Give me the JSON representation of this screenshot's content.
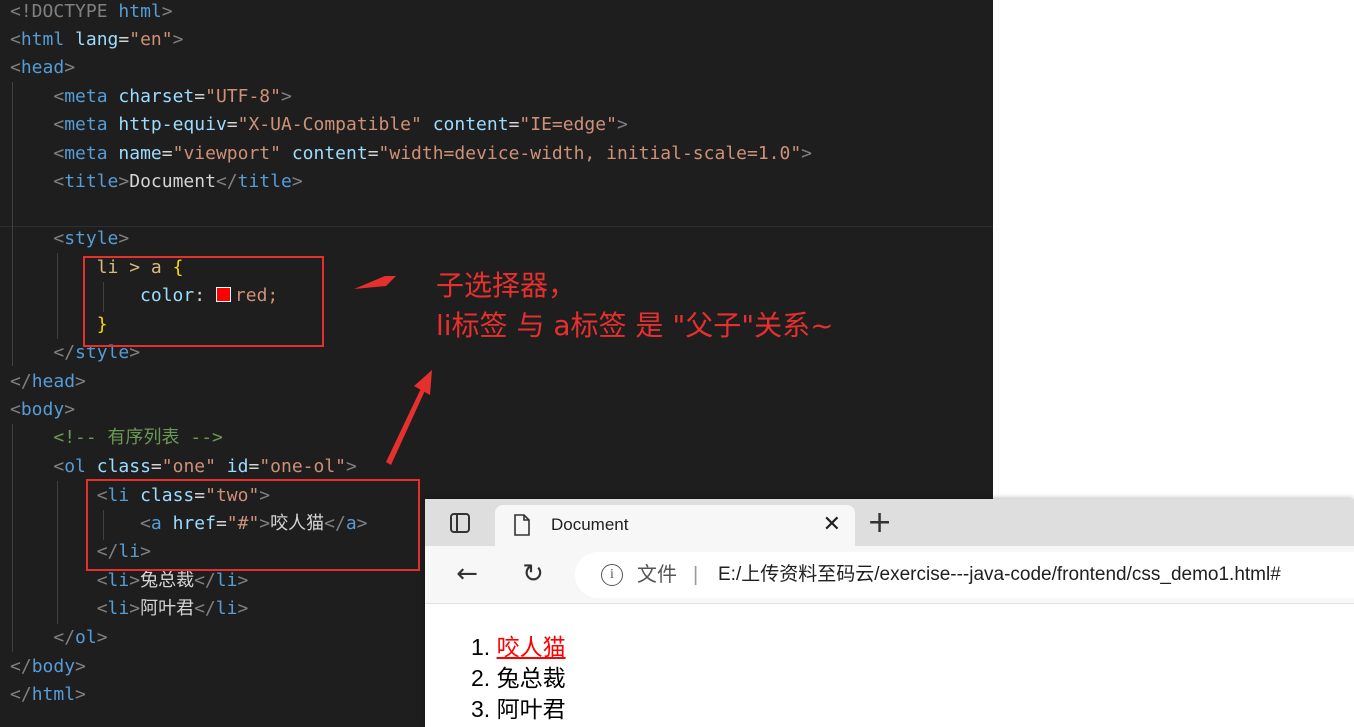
{
  "editor": {
    "doctype": "<!DOCTYPE",
    "html_kw": "html",
    "code": {
      "html": "html",
      "lang_attr": "lang",
      "lang_val": "\"en\"",
      "head": "head",
      "meta": "meta",
      "charset_attr": "charset",
      "charset_val": "\"UTF-8\"",
      "http_equiv_attr": "http-equiv",
      "http_equiv_val": "\"X-UA-Compatible\"",
      "content_attr": "content",
      "content_val_1": "\"IE=edge\"",
      "name_attr": "name",
      "name_val": "\"viewport\"",
      "content_val_2": "\"width=device-width, initial-scale=1.0\"",
      "title_tag": "title",
      "title_text": "Document",
      "style_tag": "style",
      "selector": "li > a",
      "open_brace": "{",
      "prop": "color",
      "value": "red;",
      "close_brace": "}",
      "body": "body",
      "comment": "<!-- 有序列表 -->",
      "ol": "ol",
      "class_attr": "class",
      "class_one": "\"one\"",
      "id_attr": "id",
      "id_val": "\"one-ol\"",
      "li": "li",
      "class_two": "\"two\"",
      "a": "a",
      "href_attr": "href",
      "href_val": "\"#\"",
      "item1": "咬人猫",
      "item2": "兔总裁",
      "item3": "阿叶君"
    }
  },
  "annotation": {
    "line1": "子选择器，",
    "line2": "li标签 与 a标签 是 \"父子\"关系~"
  },
  "browser": {
    "tab_title": "Document",
    "url_label": "文件",
    "url_separator": "|",
    "url": "E:/上传资料至码云/exercise---java-code/frontend/css_demo1.html#",
    "list": [
      {
        "num": "1.",
        "text": "咬人猫"
      },
      {
        "num": "2.",
        "text": "兔总裁"
      },
      {
        "num": "3.",
        "text": "阿叶君"
      }
    ],
    "link_color": "#ff0000"
  },
  "colors": {
    "editor_bg": "#1e1e1e",
    "tag": "#569cd6",
    "attr": "#9cdcfe",
    "string": "#ce9178",
    "comment": "#6a9955",
    "annotation": "#e5302e"
  }
}
